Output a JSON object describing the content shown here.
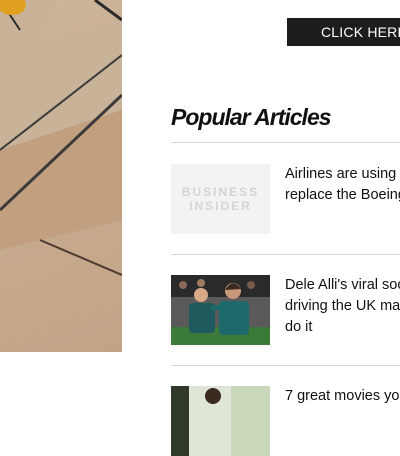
{
  "cta": {
    "label": "CLICK HERE"
  },
  "popular": {
    "title": "Popular Articles",
    "articles": [
      {
        "lines": [
          "Airlines are using",
          "replace the Boeing"
        ],
        "thumb": {
          "type": "logo",
          "logo_lines": [
            "BUSINESS",
            "INSIDER"
          ]
        }
      },
      {
        "lines": [
          "Dele Alli's viral soc",
          "driving the UK ma",
          "do it"
        ],
        "thumb": {
          "type": "photo",
          "description_icon": "football-players-photo"
        }
      },
      {
        "lines": [
          "7 great movies yo"
        ],
        "thumb": {
          "type": "photo",
          "description_icon": "person-photo"
        }
      }
    ]
  },
  "colors": {
    "button_bg": "#1d1d1d",
    "divider": "#d9d9d9",
    "text": "#111111"
  }
}
